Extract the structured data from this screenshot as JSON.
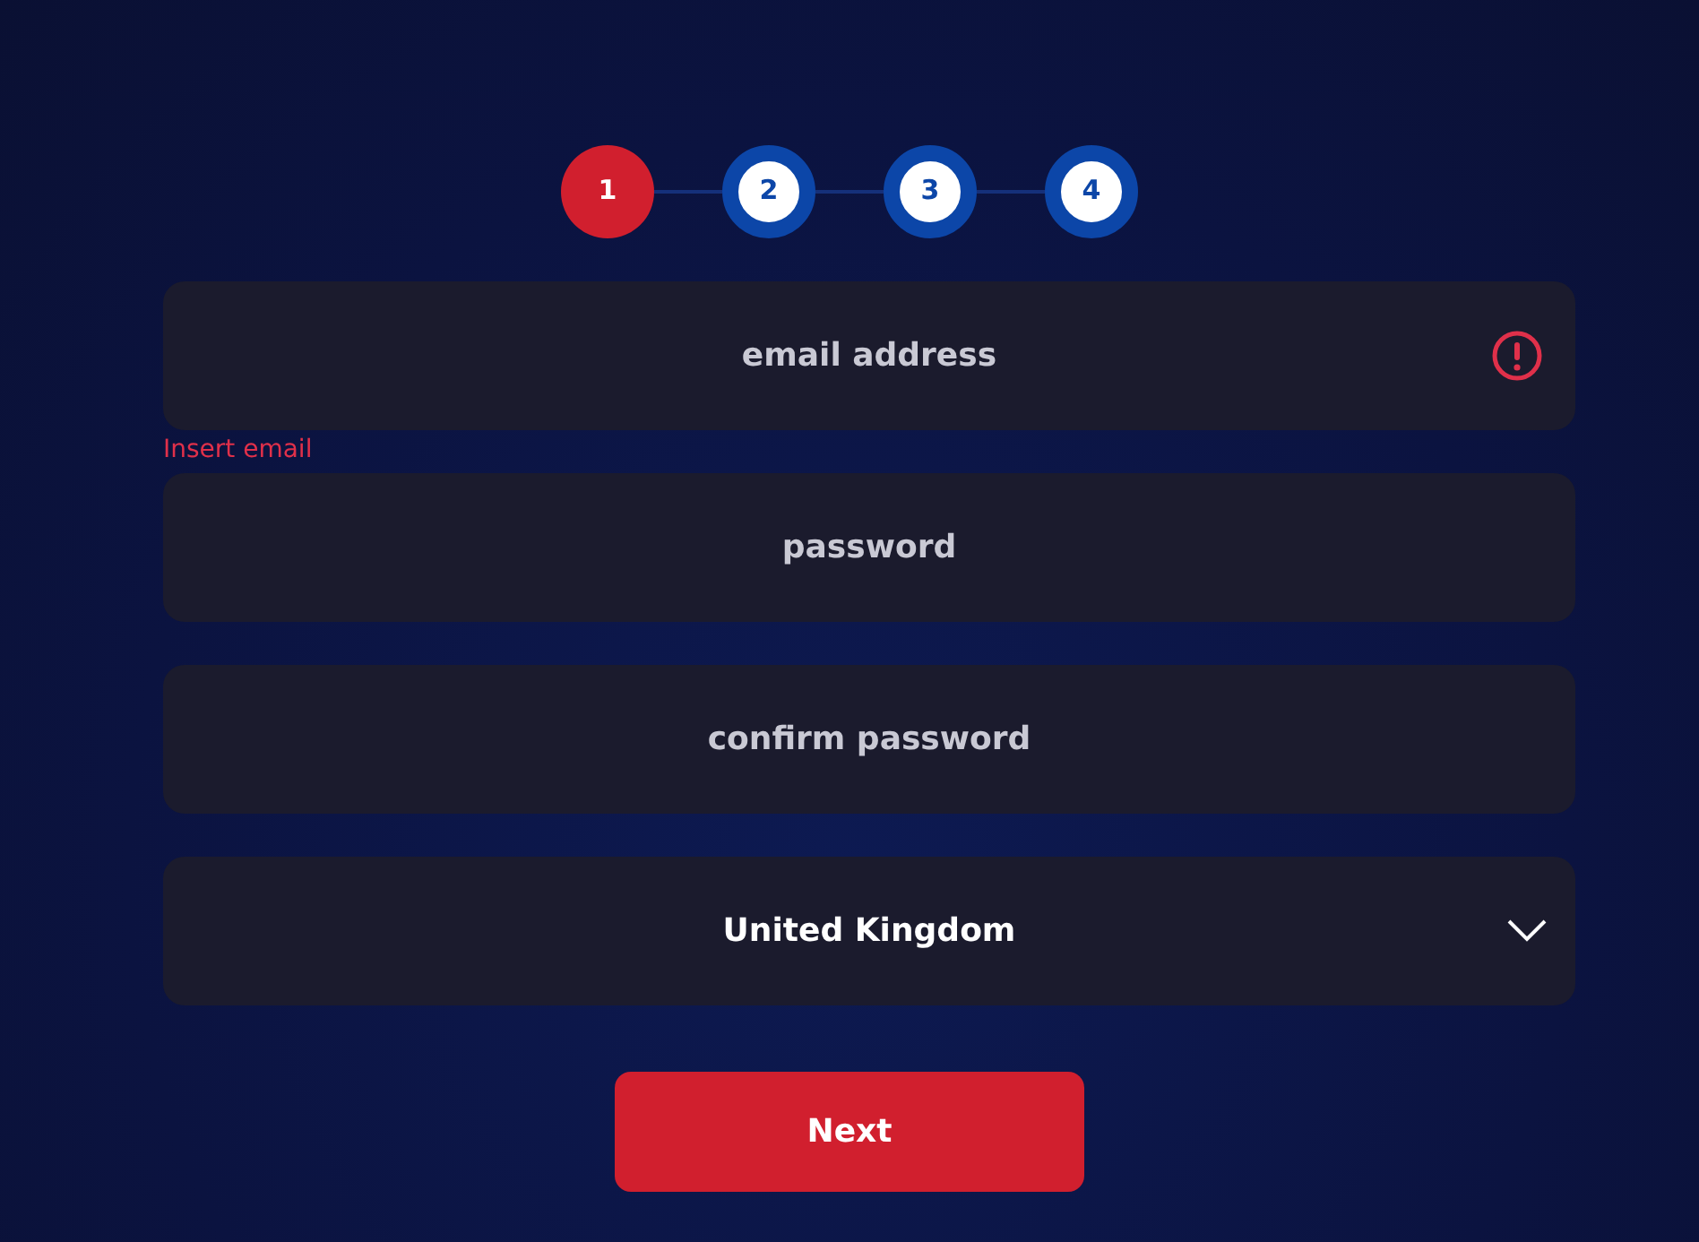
{
  "steps": [
    {
      "label": "1",
      "selected": true
    },
    {
      "label": "2",
      "selected": false
    },
    {
      "label": "3",
      "selected": false
    },
    {
      "label": "4",
      "selected": false
    }
  ],
  "fields": [
    {
      "kind": "text",
      "placeholder": "email address",
      "invalid": true,
      "error": "Insert email"
    },
    {
      "kind": "text",
      "placeholder": "password",
      "invalid": false
    },
    {
      "kind": "text",
      "placeholder": "confirm password",
      "invalid": false
    },
    {
      "kind": "select",
      "value": "United Kingdom"
    }
  ],
  "button": "Next"
}
